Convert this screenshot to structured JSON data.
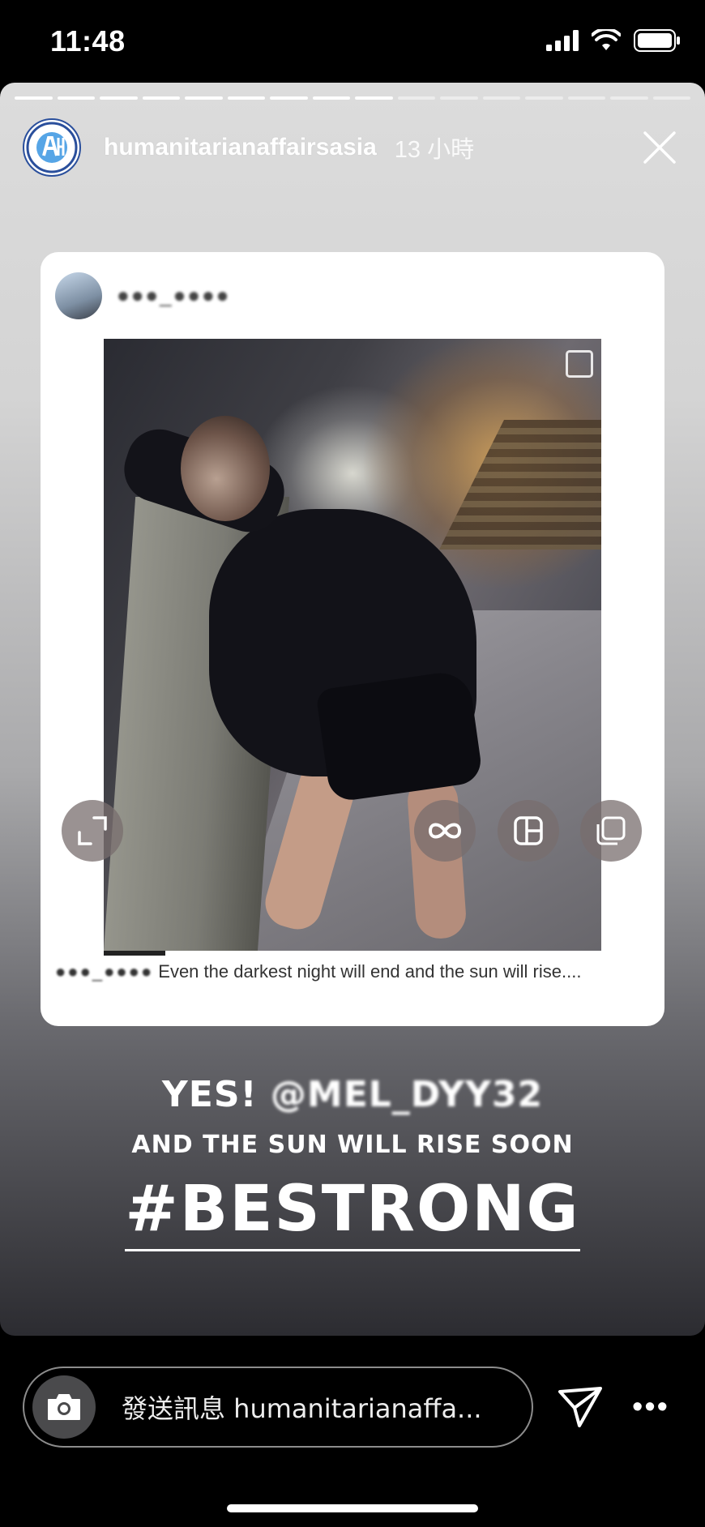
{
  "status_bar": {
    "time": "11:48",
    "icons": [
      "cellular-signal-icon",
      "wifi-icon",
      "battery-icon"
    ]
  },
  "story": {
    "segments_total": 16,
    "segments_done": 9,
    "username": "humanitarianaffairsasia",
    "time_ago": "13 小時",
    "close_icon": "close-icon"
  },
  "shared_post": {
    "username": "●●●_●●●●",
    "caption_user": "●●●_●●●●",
    "caption": "Even the darkest night will end and the sun will rise....",
    "overlay_buttons": [
      "expand-icon",
      "boomerang-icon",
      "layout-icon",
      "multiple-icon"
    ]
  },
  "story_text": {
    "line1_prefix": "YES! ",
    "line1_mention": "@MEL_DYY32",
    "line2": "AND THE SUN WILL RISE SOON",
    "line3": "#BESTRONG"
  },
  "reply": {
    "placeholder": "發送訊息 humanitarianaffa...",
    "camera_icon": "camera-icon",
    "send_icon": "send-icon",
    "more_icon": "more-icon",
    "more_label": "•••"
  },
  "colors": {
    "background": "#000000",
    "card": "#ffffff",
    "text": "#ffffff",
    "brand_blue": "#2a4f9c"
  }
}
